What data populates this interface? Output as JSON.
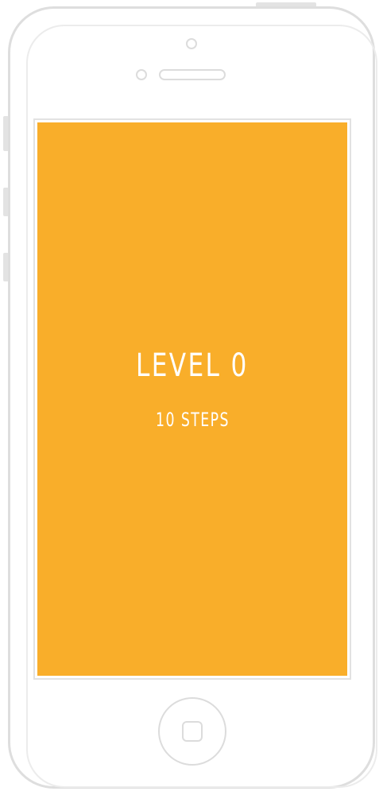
{
  "colors": {
    "screen_background": "#f9ae2a",
    "text": "#ffffff",
    "device_frame": "#dedede"
  },
  "device": {
    "frame_icon": "iphone-outline",
    "home_button_icon": "rounded-square"
  },
  "level": {
    "title": "LEVEL 0",
    "steps": "10 STEPS"
  }
}
